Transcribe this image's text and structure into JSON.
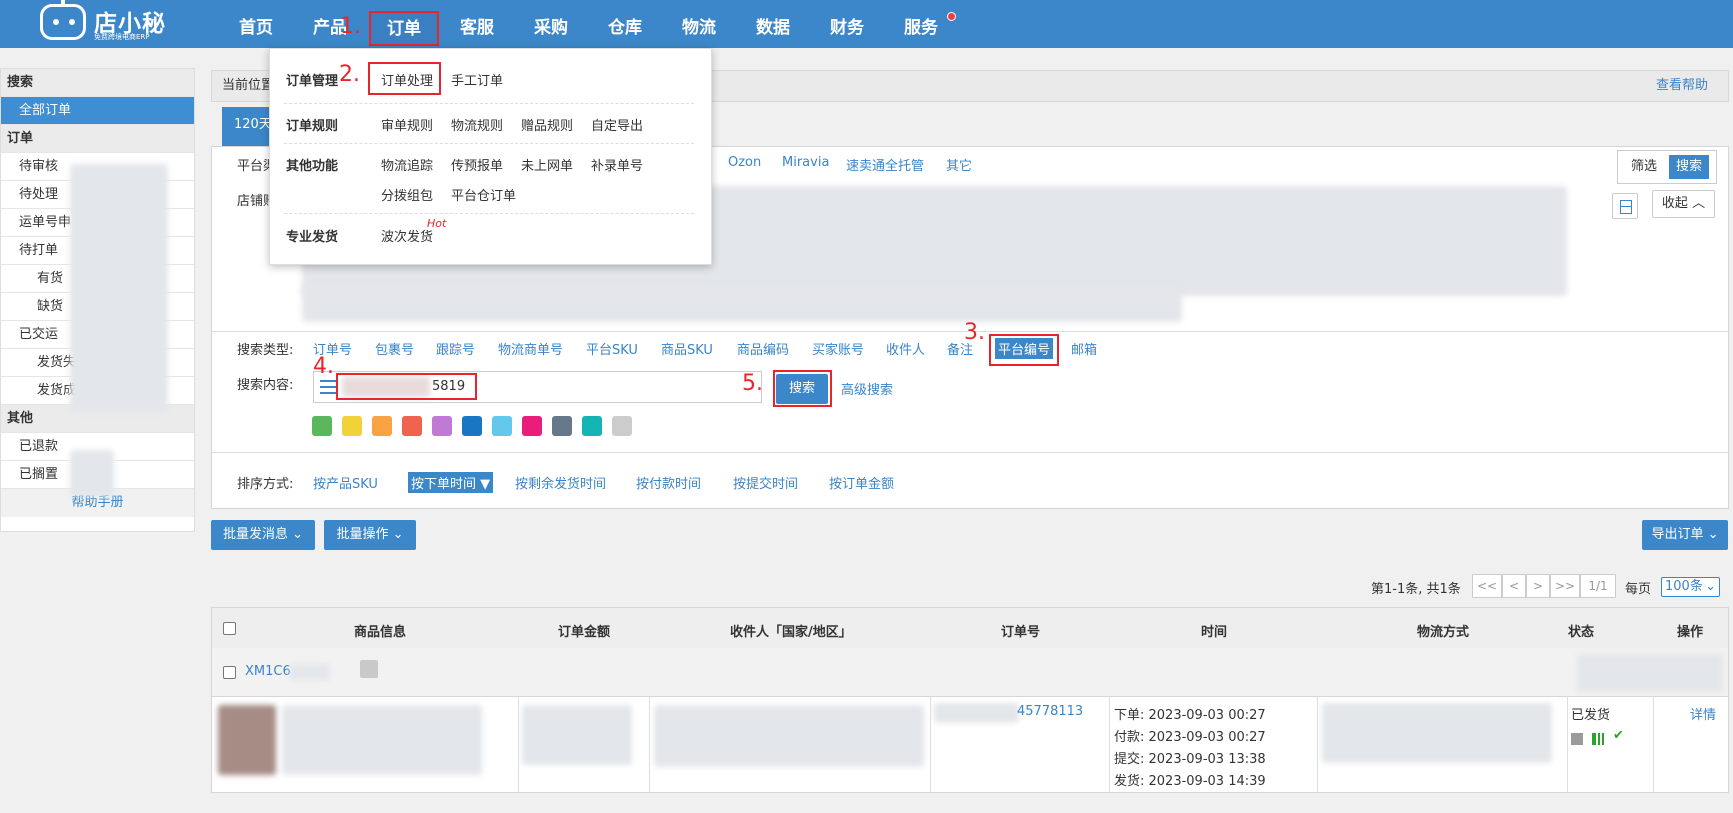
{
  "header": {
    "logo_name": "店小秘",
    "logo_sub": "免费跨境电商ERP",
    "nav": [
      "首页",
      "产品",
      "订单",
      "客服",
      "采购",
      "仓库",
      "物流",
      "数据",
      "财务",
      "服务"
    ]
  },
  "steps": [
    "1.",
    "2.",
    "3.",
    "4.",
    "5."
  ],
  "menu": {
    "sections": [
      {
        "title": "订单管理",
        "items": [
          "订单处理",
          "手工订单"
        ]
      },
      {
        "title": "订单规则",
        "items": [
          "审单规则",
          "物流规则",
          "赠品规则",
          "自定导出"
        ]
      },
      {
        "title": "其他功能",
        "items": [
          "物流追踪",
          "传预报单",
          "未上网单",
          "补录单号",
          "分拨组包",
          "平台仓订单"
        ]
      },
      {
        "title": "专业发货",
        "items": [
          "波次发货"
        ]
      }
    ],
    "hot_badge": "Hot"
  },
  "sidebar": {
    "search_head": "搜索",
    "all_orders": "全部订单",
    "order_head": "订单",
    "order_items": [
      "待审核",
      "待处理",
      "运单号申",
      "待打单",
      "有货",
      "缺货",
      "已交运",
      "发货失",
      "发货成"
    ],
    "other_head": "其他",
    "other_items": [
      "已退款",
      "已搁置"
    ],
    "help": "帮助手册"
  },
  "breadcrumb": {
    "label": "当前位置",
    "help": "查看帮助"
  },
  "tab_label": "120天",
  "filters": {
    "platform_label": "平台渠",
    "shop_label": "店铺账",
    "platforms": [
      "Ozon",
      "Miravia",
      "速卖通全托管",
      "其它"
    ],
    "filter_btn": "筛选",
    "search_btn": "搜索",
    "collapse_btn": "收起"
  },
  "search": {
    "type_label": "搜索类型:",
    "types": [
      "订单号",
      "包裹号",
      "跟踪号",
      "物流商单号",
      "平台SKU",
      "商品SKU",
      "商品编码",
      "买家账号",
      "收件人",
      "备注",
      "平台编号",
      "邮箱"
    ],
    "selected_type": "平台编号",
    "content_label": "搜索内容:",
    "input_value": "5819",
    "button": "搜索",
    "advanced": "高级搜索"
  },
  "color_tags": [
    "#5bb75b",
    "#f2d23b",
    "#f8a243",
    "#ee6450",
    "#c07ad6",
    "#1976c3",
    "#64c8ec",
    "#e91e7a",
    "#66798a",
    "#14b4b4",
    "#cccccc"
  ],
  "sort": {
    "label": "排序方式:",
    "options": [
      "按产品SKU",
      "按下单时间",
      "按剩余发货时间",
      "按付款时间",
      "按提交时间",
      "按订单金额"
    ],
    "selected": "按下单时间"
  },
  "actions": {
    "batch_msg": "批量发消息",
    "batch_ops": "批量操作",
    "export": "导出订单"
  },
  "pager": {
    "summary": "第1-1条, 共1条",
    "first": "<<",
    "prev": "<",
    "next": ">",
    "last": ">>",
    "page": "1/1",
    "per_page_label": "每页",
    "per_page": "100条"
  },
  "table": {
    "headers": [
      "商品信息",
      "订单金额",
      "收件人「国家/地区」",
      "订单号",
      "时间",
      "物流方式",
      "状态",
      "操作"
    ],
    "order_id": "XM1C6",
    "order_no": "45778113",
    "times": [
      "下单: 2023-09-03 00:27",
      "付款: 2023-09-03 00:27",
      "提交: 2023-09-03 13:38",
      "发货: 2023-09-03 14:39"
    ],
    "status": "已发货",
    "detail": "详情"
  }
}
